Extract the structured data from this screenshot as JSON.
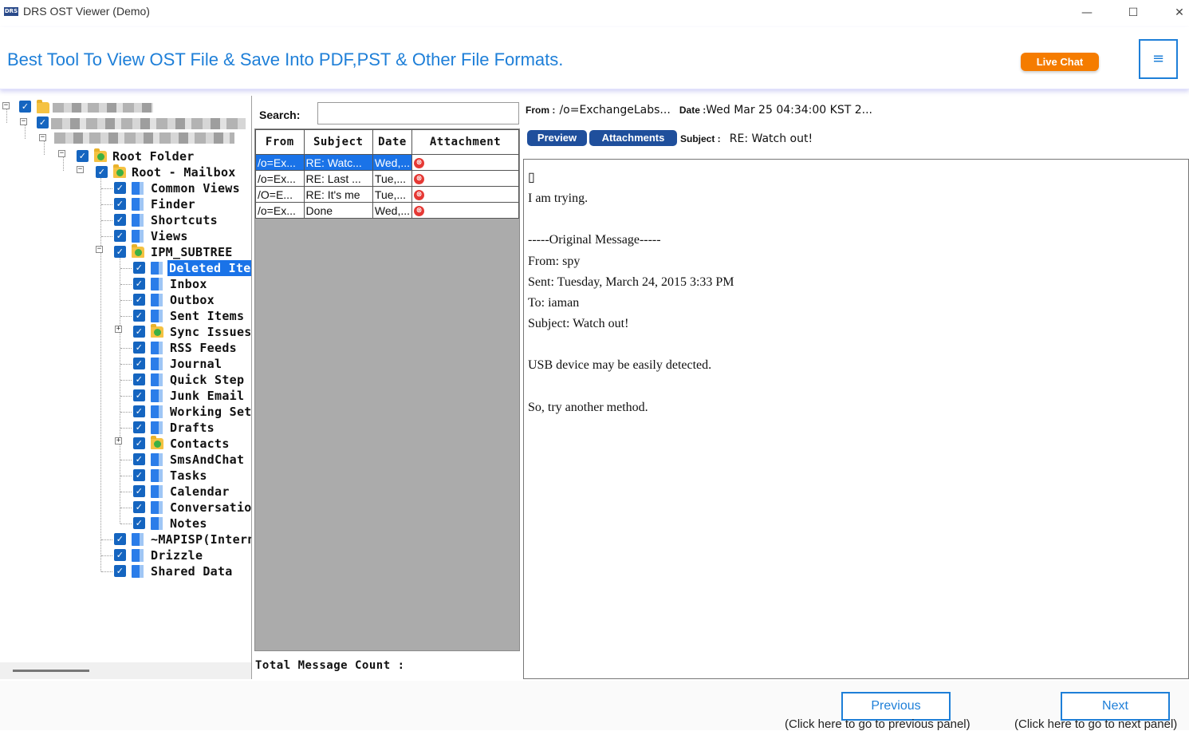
{
  "window": {
    "badge": "DRS",
    "title": "DRS OST Viewer (Demo)",
    "minimize": "—",
    "maximize": "☐",
    "close": "✕"
  },
  "header": {
    "tagline": "Best Tool To View OST File & Save Into PDF,PST & Other File Formats.",
    "live_chat": "Live Chat",
    "menu_icon": "≡"
  },
  "tree": {
    "selected": "Deleted Items",
    "nodes": [
      {
        "label": "Root Folder",
        "icon": "folder-icon"
      },
      {
        "label": "Root - Mailbox",
        "icon": "folder-icon"
      },
      {
        "label": "Common Views",
        "icon": "folder-blue-icon"
      },
      {
        "label": "Finder",
        "icon": "folder-blue-icon"
      },
      {
        "label": "Shortcuts",
        "icon": "folder-blue-icon"
      },
      {
        "label": "Views",
        "icon": "folder-blue-icon"
      },
      {
        "label": "IPM_SUBTREE",
        "icon": "folder-icon"
      },
      {
        "label": "Deleted Item",
        "icon": "folder-blue-icon"
      },
      {
        "label": "Inbox",
        "icon": "folder-blue-icon"
      },
      {
        "label": "Outbox",
        "icon": "folder-blue-icon"
      },
      {
        "label": "Sent Items",
        "icon": "folder-blue-icon"
      },
      {
        "label": "Sync Issues",
        "icon": "folder-icon"
      },
      {
        "label": "RSS Feeds",
        "icon": "folder-blue-icon"
      },
      {
        "label": "Journal",
        "icon": "folder-blue-icon"
      },
      {
        "label": "Quick Step S",
        "icon": "folder-blue-icon"
      },
      {
        "label": "Junk Email",
        "icon": "folder-blue-icon"
      },
      {
        "label": "Working Set",
        "icon": "folder-blue-icon"
      },
      {
        "label": "Drafts",
        "icon": "folder-blue-icon"
      },
      {
        "label": "Contacts",
        "icon": "folder-icon"
      },
      {
        "label": "SmsAndChat",
        "icon": "folder-blue-icon"
      },
      {
        "label": "Tasks",
        "icon": "folder-blue-icon"
      },
      {
        "label": "Calendar",
        "icon": "folder-blue-icon"
      },
      {
        "label": "Conversation",
        "icon": "folder-blue-icon"
      },
      {
        "label": "Notes",
        "icon": "folder-blue-icon"
      },
      {
        "label": "~MAPISP(Intern",
        "icon": "folder-blue-icon"
      },
      {
        "label": "Drizzle",
        "icon": "folder-blue-icon"
      },
      {
        "label": "Shared Data",
        "icon": "folder-blue-icon"
      }
    ]
  },
  "list": {
    "search_label": "Search:",
    "search_value": "",
    "columns": [
      "From",
      "Subject",
      "Date",
      "Attachment"
    ],
    "rows": [
      {
        "from": "/o=Ex...",
        "subject": "RE: Watc...",
        "date": "Wed,...",
        "attachment": "attachment-icon",
        "selected": true
      },
      {
        "from": "/o=Ex...",
        "subject": "RE: Last ...",
        "date": "Tue,...",
        "attachment": "attachment-icon",
        "selected": false
      },
      {
        "from": "/O=E...",
        "subject": "RE: It's me",
        "date": "Tue,...",
        "attachment": "attachment-icon",
        "selected": false
      },
      {
        "from": "/o=Ex...",
        "subject": "Done",
        "date": "Wed,...",
        "attachment": "attachment-icon",
        "selected": false
      }
    ],
    "total_label": "Total Message Count :"
  },
  "preview": {
    "from_key": "From :",
    "from_value": "/o=ExchangeLabs...",
    "date_key": "Date :",
    "date_value": "Wed Mar 25 04:34:00 KST 2...",
    "preview_tab": "Preview",
    "attachments_tab": "Attachments",
    "subject_key": "Subject :",
    "subject_value": "RE: Watch out!",
    "body_lines": [
      "▯",
      "I am trying.",
      "",
      "-----Original Message-----",
      "From: spy",
      "Sent: Tuesday, March 24, 2015 3:33 PM",
      "To: iaman",
      "Subject: Watch out!",
      "",
      "USB device may be easily detected.",
      "",
      "So, try another method."
    ]
  },
  "nav": {
    "previous": "Previous",
    "previous_hint": "(Click here to go to previous panel)",
    "next": "Next",
    "next_hint": "(Click here to go to next panel)"
  },
  "colors": {
    "accent": "#1e7fd8",
    "live_chat": "#f57c00",
    "selection": "#1a73e8",
    "pill": "#1f4f9c"
  }
}
